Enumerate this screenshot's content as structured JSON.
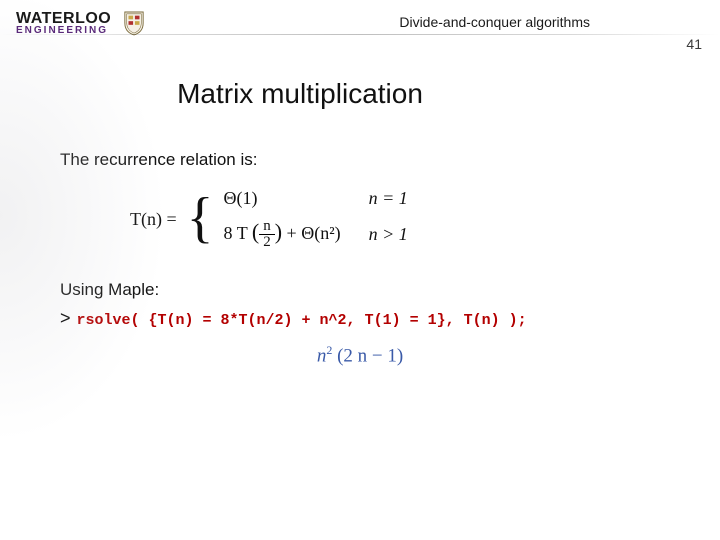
{
  "header": {
    "logo_line1": "WATERLOO",
    "logo_line2": "ENGINEERING",
    "topic": "Divide-and-conquer algorithms",
    "page_number": "41"
  },
  "slide": {
    "title": "Matrix multiplication",
    "intro": "The recurrence relation is:",
    "recurrence": {
      "lhs": "T(n) =",
      "case1_expr": "Θ(1)",
      "case1_cond": "n = 1",
      "case2_prefix": "8 T",
      "case2_frac_num": "n",
      "case2_frac_den": "2",
      "case2_suffix": "+ Θ(n²)",
      "case2_cond": "n > 1"
    },
    "using": "Using Maple:",
    "maple_prompt": ">",
    "maple_input": "rsolve( {T(n) = 8*T(n/2) + n^2, T(1) = 1}, T(n) );",
    "maple_output_prefix": "n",
    "maple_output_exp": "2",
    "maple_output_rest": " (2 n − 1)"
  }
}
